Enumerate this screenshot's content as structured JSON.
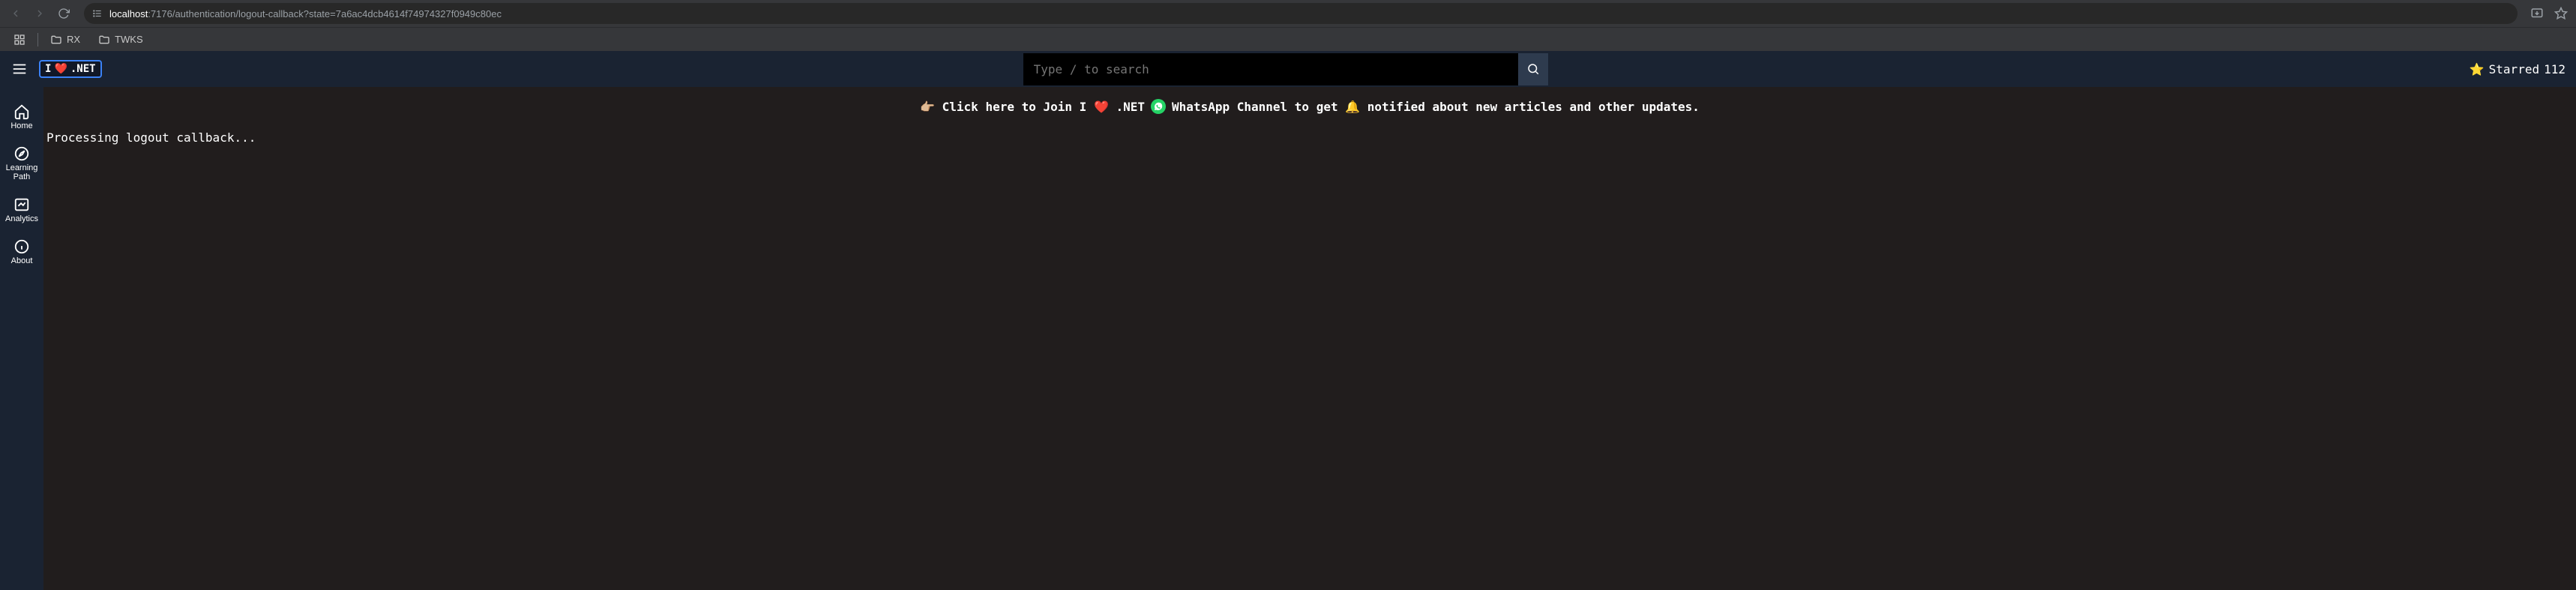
{
  "browser": {
    "url_host": "localhost",
    "url_rest": ":7176/authentication/logout-callback?state=7a6ac4dcb4614f74974327f0949c80ec",
    "bookmarks": [
      "RX",
      "TWKS"
    ]
  },
  "header": {
    "logo_text_1": "I",
    "logo_heart": "❤️",
    "logo_text_2": ".NET",
    "search_placeholder": "Type / to search",
    "starred_label": "Starred",
    "starred_count": "112"
  },
  "sidebar": {
    "items": [
      {
        "label": "Home"
      },
      {
        "label": "Learning Path"
      },
      {
        "label": "Analytics"
      },
      {
        "label": "About"
      }
    ]
  },
  "banner": {
    "pre": "👉🏼 Click here to Join I ❤️ .NET",
    "mid": "WhatsApp Channel to get 🔔 notified about new articles and other updates."
  },
  "main": {
    "status": "Processing logout callback..."
  }
}
